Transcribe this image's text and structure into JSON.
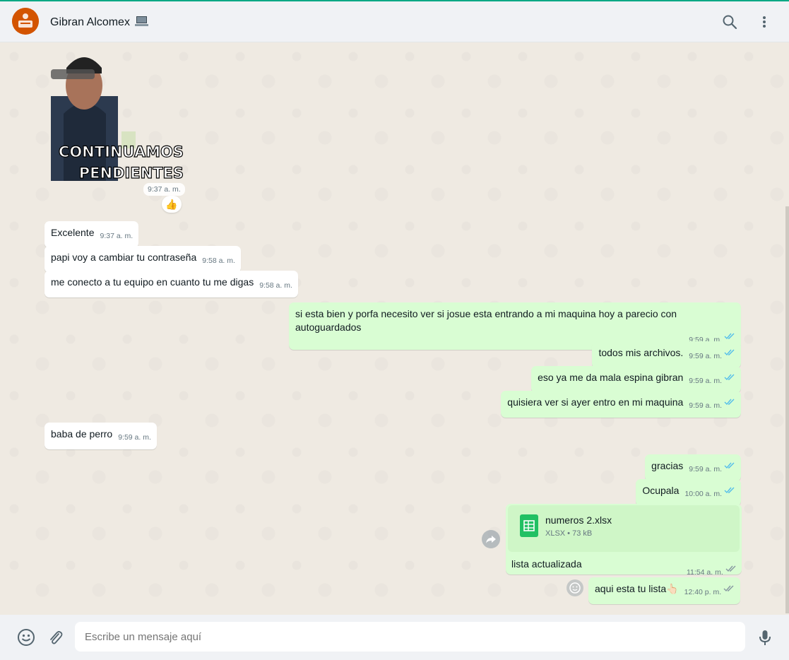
{
  "header": {
    "contact_name": "Gibran Alcomex",
    "status_emoji": "laptop-icon"
  },
  "sticker": {
    "text_line1": "CONTINUAMOS",
    "text_line2": "PENDIENTES",
    "time": "9:37 a. m.",
    "reaction": "👍"
  },
  "messages": [
    {
      "dir": "in",
      "text": "Excelente",
      "time": "9:37 a. m."
    },
    {
      "dir": "in",
      "text": "papi voy a cambiar tu contraseña",
      "time": "9:58 a. m."
    },
    {
      "dir": "in",
      "text": "me conecto a tu equipo en cuanto tu me digas",
      "time": "9:58 a. m."
    },
    {
      "dir": "out",
      "text": "si esta bien y porfa necesito ver si josue esta entrando a mi maquina hoy a parecio con autoguardados",
      "time": "9:59 a. m."
    },
    {
      "dir": "out",
      "text": "todos mis archivos.",
      "time": "9:59 a. m."
    },
    {
      "dir": "out",
      "text": "eso ya me da mala espina gibran",
      "time": "9:59 a. m."
    },
    {
      "dir": "out",
      "text": "quisiera ver si ayer entro en mi maquina",
      "time": "9:59 a. m."
    },
    {
      "dir": "in",
      "text": "baba de perro",
      "time": "9:59 a. m."
    },
    {
      "dir": "out",
      "text": "gracias",
      "time": "9:59 a. m."
    },
    {
      "dir": "out",
      "text": "Ocupala",
      "time": "10:00 a. m."
    }
  ],
  "file_message": {
    "file_name": "numeros 2.xlsx",
    "file_meta": "XLSX • 73 kB",
    "caption": "lista actualizada",
    "time": "11:54 a. m."
  },
  "last_message": {
    "text": "aqui esta tu lista👆🏻",
    "time": "12:40 p. m."
  },
  "composer": {
    "placeholder": "Escribe un mensaje aquí"
  },
  "colors": {
    "outgoing_bubble": "#d9fdd3",
    "incoming_bubble": "#ffffff",
    "read_ticks": "#53bdeb",
    "chat_background": "#efeae2",
    "accent": "#00a884"
  }
}
